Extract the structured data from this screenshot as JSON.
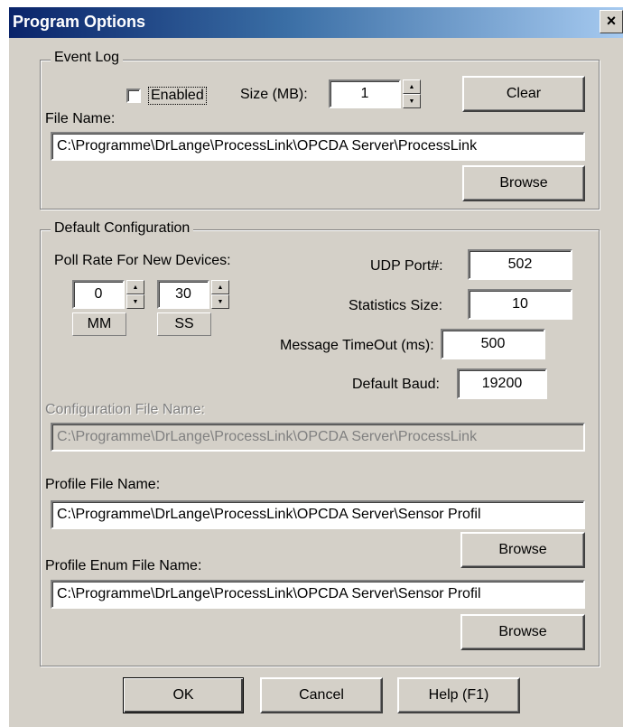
{
  "window": {
    "title": "Program Options",
    "close_glyph": "×",
    "close_icon": "close-icon"
  },
  "event_log": {
    "legend": "Event Log",
    "enabled_label": "Enabled",
    "enabled_checked": false,
    "size_label": "Size (MB):",
    "size_value": "1",
    "clear_label": "Clear",
    "file_name_label": "File Name:",
    "file_name_value": "C:\\Programme\\DrLange\\ProcessLink\\OPCDA Server\\ProcessLink",
    "browse_label": "Browse"
  },
  "default_config": {
    "legend": "Default Configuration",
    "poll_rate_label": "Poll Rate For New Devices:",
    "poll_mm_value": "0",
    "poll_ss_value": "30",
    "mm_label": "MM",
    "ss_label": "SS",
    "udp_port_label": "UDP Port#:",
    "udp_port_value": "502",
    "statistics_size_label": "Statistics Size:",
    "statistics_size_value": "10",
    "message_timeout_label": "Message TimeOut (ms):",
    "message_timeout_value": "500",
    "default_baud_label": "Default Baud:",
    "default_baud_value": "19200",
    "config_file_label": "Configuration File Name:",
    "config_file_value": "C:\\Programme\\DrLange\\ProcessLink\\OPCDA Server\\ProcessLink",
    "profile_file_label": "Profile File Name:",
    "profile_file_value": "C:\\Programme\\DrLange\\ProcessLink\\OPCDA Server\\Sensor Profil",
    "profile_browse_label": "Browse",
    "profile_enum_label": "Profile Enum File Name:",
    "profile_enum_value": "C:\\Programme\\DrLange\\ProcessLink\\OPCDA Server\\Sensor Profil",
    "profile_enum_browse_label": "Browse"
  },
  "footer": {
    "ok_label": "OK",
    "cancel_label": "Cancel",
    "help_label": "Help (F1)"
  }
}
